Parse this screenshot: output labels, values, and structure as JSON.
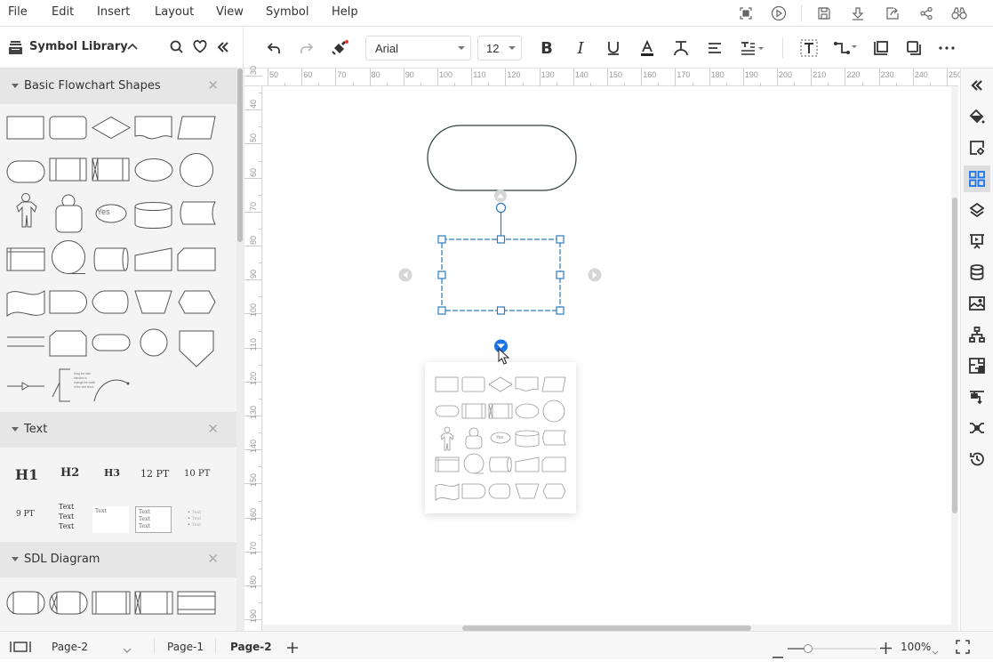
{
  "menu": {
    "items": [
      "File",
      "Edit",
      "Insert",
      "Layout",
      "View",
      "Symbol",
      "Help"
    ],
    "right_icons": [
      "fullscreen-icon",
      "play-icon",
      "save-icon",
      "download-icon",
      "export-icon",
      "share-icon",
      "find-icon"
    ]
  },
  "library": {
    "title": "Symbol Library",
    "sections": [
      {
        "label": "Basic Flowchart Shapes"
      },
      {
        "label": "Text"
      },
      {
        "label": "SDL Diagram"
      }
    ],
    "text_items": [
      "H1",
      "H2",
      "H3",
      "12 PT",
      "10 PT",
      "9 PT",
      "Text",
      "Text",
      "Text"
    ],
    "bubble_text": "Yes",
    "note_text": "Drag the side handles to change the width of the text block."
  },
  "toolbar": {
    "font": "Arial",
    "font_size": "12",
    "format_paint_has_badge": true,
    "badge_color": "#e53935"
  },
  "ruler": {
    "top": [
      "50",
      "60",
      "70",
      "80",
      "90",
      "100",
      "110",
      "120",
      "130",
      "140",
      "150",
      "160",
      "170",
      "180",
      "190",
      "200",
      "210",
      "220",
      "230",
      "240",
      "250"
    ],
    "left": [
      "30",
      "40",
      "50",
      "60",
      "70",
      "80",
      "90",
      "100",
      "110",
      "120",
      "130",
      "140",
      "150",
      "160",
      "170",
      "180",
      "190"
    ]
  },
  "canvas": {
    "popup_bubble_text": "Yes",
    "selection_color": "#2b7bbf",
    "accent": "#1a73e8"
  },
  "right_panel": {
    "icons": [
      "collapse-icon",
      "fill-icon",
      "shape-settings-icon",
      "symbol-library-icon",
      "layers-icon",
      "presentation-icon",
      "data-icon",
      "image-icon",
      "org-chart-icon",
      "floor-plan-icon",
      "connector-icon",
      "shuffle-icon",
      "history-icon"
    ],
    "active_index": 3
  },
  "status": {
    "current_page_select": "Page-2",
    "tabs": [
      "Page-1",
      "Page-2"
    ],
    "active_tab": "Page-2",
    "zoom": "100%",
    "zoom_fraction": 0.23
  }
}
